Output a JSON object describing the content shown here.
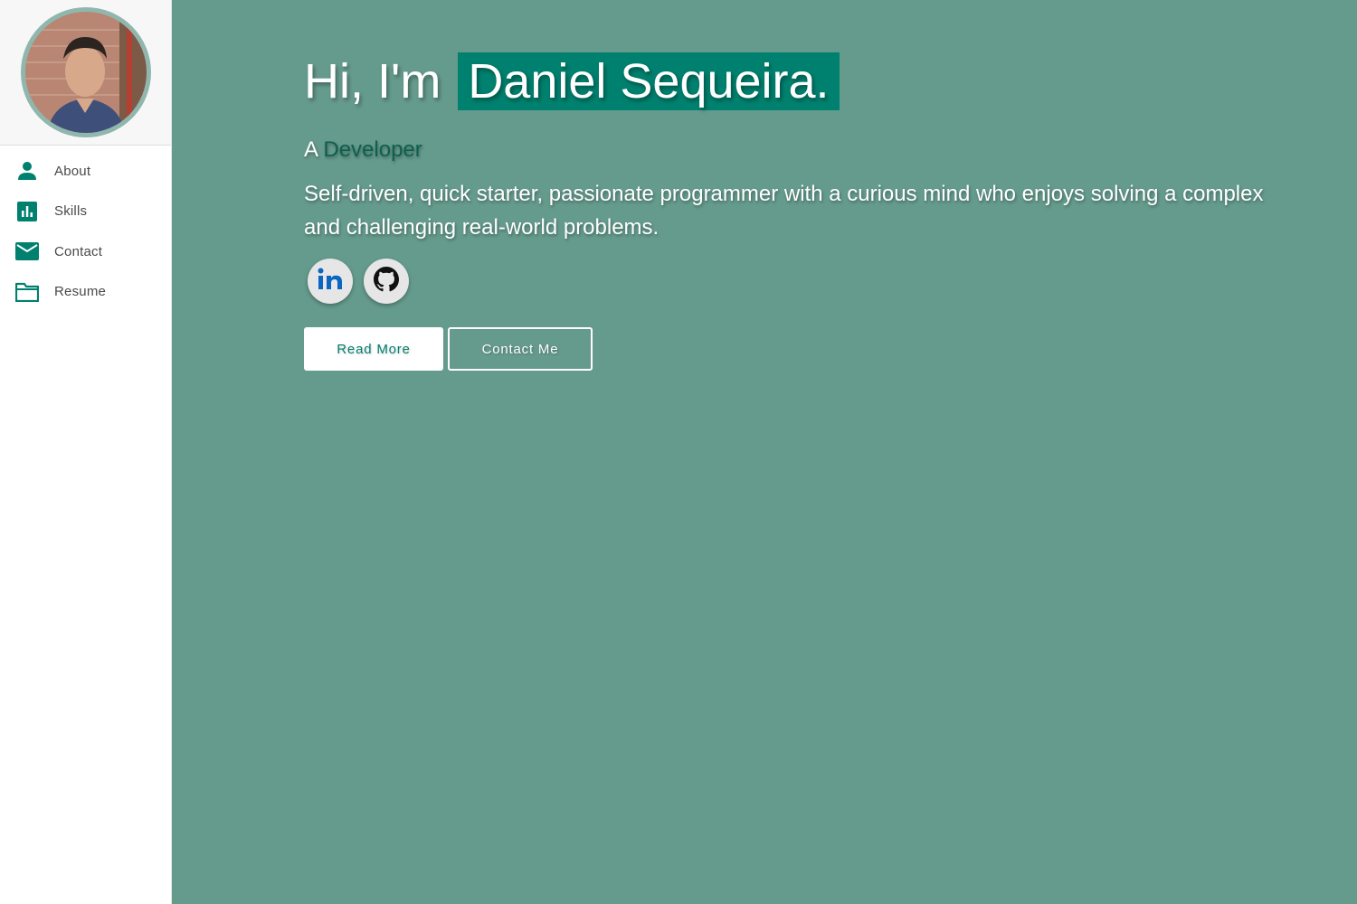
{
  "sidebar": {
    "avatar_alt": "Profile photo",
    "items": [
      {
        "label": "About",
        "icon": "person-icon"
      },
      {
        "label": "Skills",
        "icon": "bar-chart-icon"
      },
      {
        "label": "Contact",
        "icon": "mail-icon"
      },
      {
        "label": "Resume",
        "icon": "folder-icon"
      }
    ]
  },
  "hero": {
    "greeting": "Hi, I'm",
    "name": "Daniel Sequeira.",
    "subtitle_prefix": "A",
    "role": "Developer",
    "tagline": "Self-driven, quick starter, passionate programmer with a curious mind who enjoys solving a complex and challenging real-world problems.",
    "socials": [
      {
        "icon": "linkedin-icon",
        "label": "LinkedIn"
      },
      {
        "icon": "github-icon",
        "label": "GitHub"
      }
    ],
    "primary_button": "Read More",
    "secondary_button": "Contact Me"
  },
  "colors": {
    "accent": "#00806e",
    "background": "#659b8d",
    "sidebar_bg": "#ffffff",
    "icon": "#00806e"
  }
}
